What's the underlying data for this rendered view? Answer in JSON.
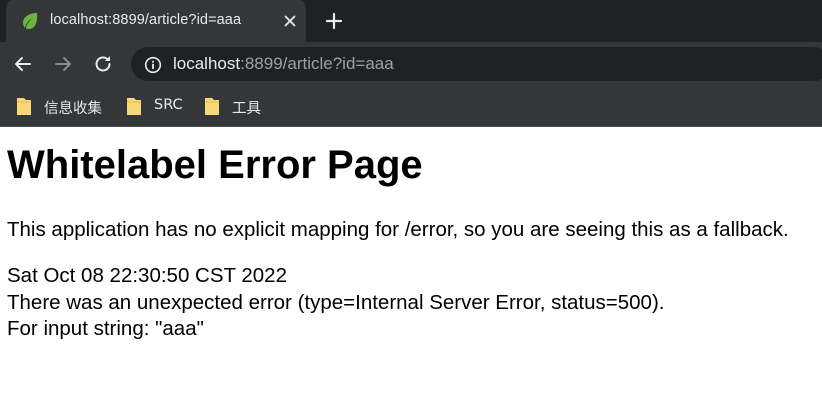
{
  "tab": {
    "title": "localhost:8899/article?id=aaa",
    "favicon": "spring-leaf-icon"
  },
  "toolbar": {
    "back_icon": "back-arrow-icon",
    "forward_icon": "forward-arrow-icon",
    "reload_icon": "reload-icon",
    "url_host": "localhost",
    "url_rest": ":8899/article?id=aaa"
  },
  "bookmarks": [
    {
      "label": "信息收集",
      "icon": "folder-icon"
    },
    {
      "label": "SRC",
      "icon": "folder-icon"
    },
    {
      "label": "工具",
      "icon": "folder-icon"
    }
  ],
  "page": {
    "title": "Whitelabel Error Page",
    "description": "This application has no explicit mapping for /error, so you are seeing this as a fallback.",
    "timestamp": "Sat Oct 08 22:30:50 CST 2022",
    "error_line": "There was an unexpected error (type=Internal Server Error, status=500).",
    "detail_line": "For input string: \"aaa\""
  },
  "colors": {
    "tabstrip_bg": "#202124",
    "toolbar_bg": "#35363a",
    "omnibox_bg": "#202124",
    "folder": "#f8d775",
    "spring_green": "#6db33f"
  }
}
